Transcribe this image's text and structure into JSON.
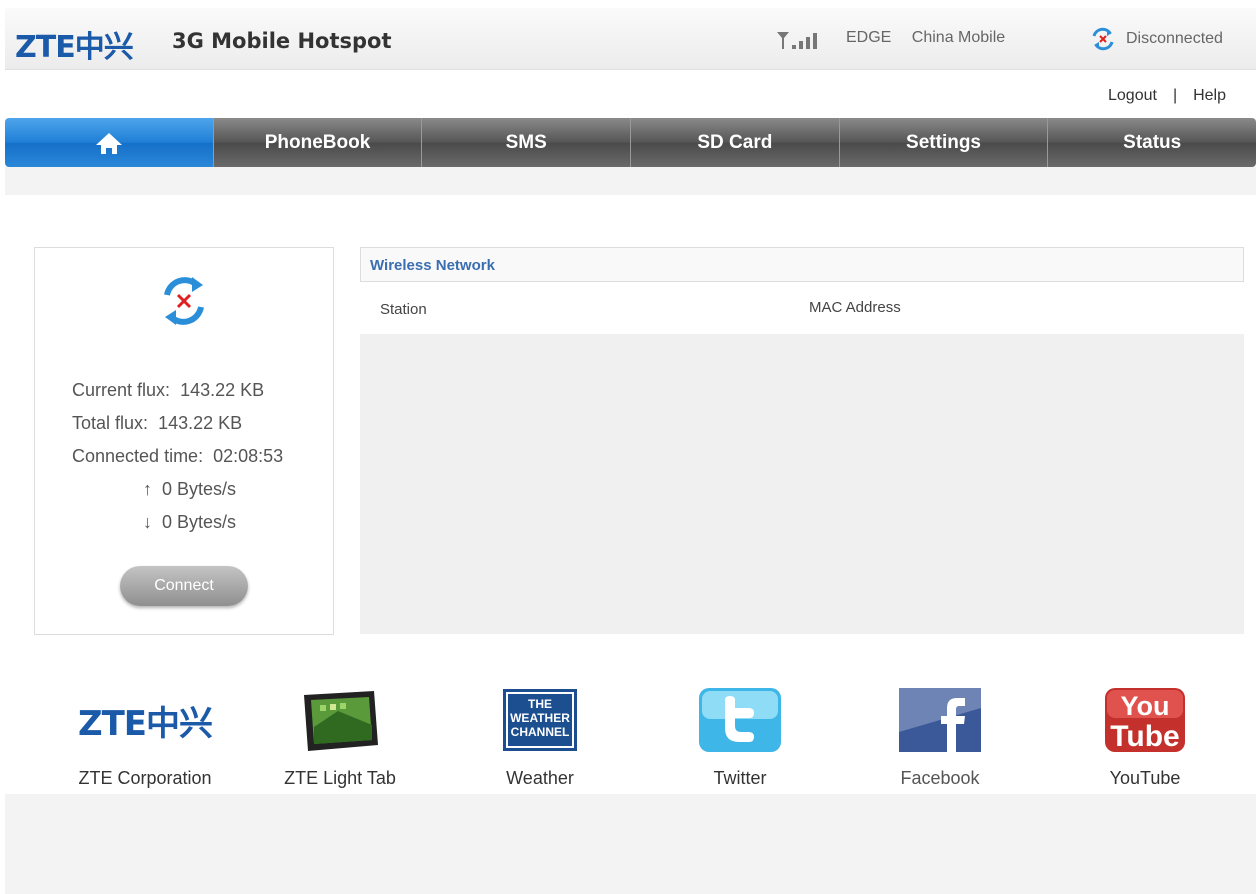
{
  "header": {
    "logo_latin": "ZTE",
    "logo_cn": "中兴",
    "product": "3G Mobile Hotspot",
    "network_type": "EDGE",
    "operator": "China Mobile",
    "connection_status": "Disconnected"
  },
  "toplinks": {
    "logout": "Logout",
    "separator": "|",
    "help": "Help"
  },
  "nav": {
    "tabs": [
      {
        "label": ""
      },
      {
        "label": "PhoneBook"
      },
      {
        "label": "SMS"
      },
      {
        "label": "SD Card"
      },
      {
        "label": "Settings"
      },
      {
        "label": "Status"
      }
    ]
  },
  "status_panel": {
    "current_flux_label": "Current flux:",
    "current_flux": "143.22 KB",
    "total_flux_label": "Total flux:",
    "total_flux": "143.22 KB",
    "connected_time_label": "Connected time:",
    "connected_time": "02:08:53",
    "upload_arrow": "↑",
    "upload_rate": "0 Bytes/s",
    "download_arrow": "↓",
    "download_rate": "0 Bytes/s",
    "connect_button": "Connect"
  },
  "wireless": {
    "title": "Wireless Network",
    "col_station": "Station",
    "col_mac": "MAC Address"
  },
  "links": [
    {
      "label": "ZTE Corporation",
      "icon": "zte-logo-icon"
    },
    {
      "label": "ZTE Light Tab",
      "icon": "tablet-icon"
    },
    {
      "label": "Weather",
      "icon": "weather-channel-icon",
      "icon_text": "THE WEATHER CHANNEL"
    },
    {
      "label": "Twitter",
      "icon": "twitter-icon"
    },
    {
      "label": "Facebook",
      "icon": "facebook-icon"
    },
    {
      "label": "YouTube",
      "icon": "youtube-icon",
      "icon_text_1": "You",
      "icon_text_2": "Tube"
    }
  ],
  "colors": {
    "brand": "#1a5aa8",
    "home_tab": "#1f7fd6",
    "nav_tab": "#555555",
    "disconnect_x": "#e02020"
  }
}
